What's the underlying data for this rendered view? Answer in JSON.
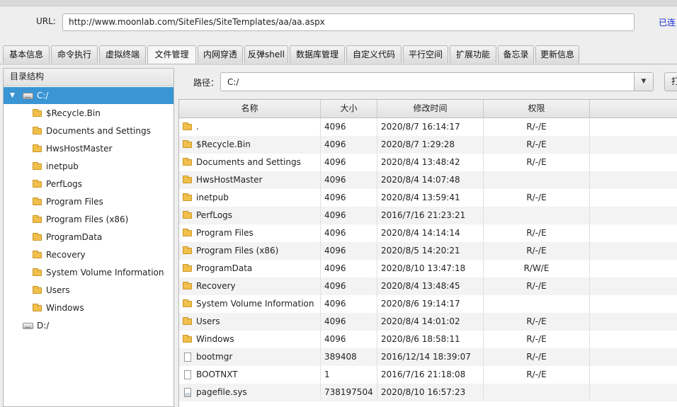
{
  "url_bar": {
    "label": "URL:",
    "value": "http://www.moonlab.com/SiteFiles/SiteTemplates/aa/aa.aspx",
    "status": "已连"
  },
  "tabs": [
    {
      "label": "基本信息"
    },
    {
      "label": "命令执行"
    },
    {
      "label": "虚拟终端"
    },
    {
      "label": "文件管理"
    },
    {
      "label": "内网穿透"
    },
    {
      "label": "反弹shell"
    },
    {
      "label": "数据库管理"
    },
    {
      "label": "自定义代码"
    },
    {
      "label": "平行空间"
    },
    {
      "label": "扩展功能"
    },
    {
      "label": "备忘录"
    },
    {
      "label": "更新信息"
    }
  ],
  "active_tab": "文件管理",
  "tree": {
    "header": "目录结构",
    "drive_c": "C:/",
    "drive_d": "D:/",
    "children": [
      {
        "label": "$Recycle.Bin"
      },
      {
        "label": "Documents and Settings"
      },
      {
        "label": "HwsHostMaster"
      },
      {
        "label": "inetpub"
      },
      {
        "label": "PerfLogs"
      },
      {
        "label": "Program Files"
      },
      {
        "label": "Program Files (x86)"
      },
      {
        "label": "ProgramData"
      },
      {
        "label": "Recovery"
      },
      {
        "label": "System Volume Information"
      },
      {
        "label": "Users"
      },
      {
        "label": "Windows"
      }
    ]
  },
  "path_bar": {
    "label": "路径：",
    "value": "C:/",
    "open_button": "打"
  },
  "table": {
    "headers": {
      "name": "名称",
      "size": "大小",
      "mtime": "修改时间",
      "perm": "权限"
    },
    "rows": [
      {
        "name": ".",
        "size": "4096",
        "mtime": "2020/8/7 16:14:17",
        "perm": "R/-/E",
        "type": "folder"
      },
      {
        "name": "$Recycle.Bin",
        "size": "4096",
        "mtime": "2020/8/7 1:29:28",
        "perm": "R/-/E",
        "type": "folder"
      },
      {
        "name": "Documents and Settings",
        "size": "4096",
        "mtime": "2020/8/4 13:48:42",
        "perm": "R/-/E",
        "type": "folder"
      },
      {
        "name": "HwsHostMaster",
        "size": "4096",
        "mtime": "2020/8/4 14:07:48",
        "perm": "",
        "type": "folder"
      },
      {
        "name": "inetpub",
        "size": "4096",
        "mtime": "2020/8/4 13:59:41",
        "perm": "R/-/E",
        "type": "folder"
      },
      {
        "name": "PerfLogs",
        "size": "4096",
        "mtime": "2016/7/16 21:23:21",
        "perm": "",
        "type": "folder"
      },
      {
        "name": "Program Files",
        "size": "4096",
        "mtime": "2020/8/4 14:14:14",
        "perm": "R/-/E",
        "type": "folder"
      },
      {
        "name": "Program Files (x86)",
        "size": "4096",
        "mtime": "2020/8/5 14:20:21",
        "perm": "R/-/E",
        "type": "folder"
      },
      {
        "name": "ProgramData",
        "size": "4096",
        "mtime": "2020/8/10 13:47:18",
        "perm": "R/W/E",
        "type": "folder"
      },
      {
        "name": "Recovery",
        "size": "4096",
        "mtime": "2020/8/4 13:48:45",
        "perm": "R/-/E",
        "type": "folder"
      },
      {
        "name": "System Volume Information",
        "size": "4096",
        "mtime": "2020/8/6 19:14:17",
        "perm": "",
        "type": "folder"
      },
      {
        "name": "Users",
        "size": "4096",
        "mtime": "2020/8/4 14:01:02",
        "perm": "R/-/E",
        "type": "folder"
      },
      {
        "name": "Windows",
        "size": "4096",
        "mtime": "2020/8/6 18:58:11",
        "perm": "R/-/E",
        "type": "folder"
      },
      {
        "name": "bootmgr",
        "size": "389408",
        "mtime": "2016/12/14 18:39:07",
        "perm": "R/-/E",
        "type": "file"
      },
      {
        "name": "BOOTNXT",
        "size": "1",
        "mtime": "2016/7/16 21:18:08",
        "perm": "R/-/E",
        "type": "file"
      },
      {
        "name": "pagefile.sys",
        "size": "738197504",
        "mtime": "2020/8/10 16:57:23",
        "perm": "",
        "type": "sys"
      }
    ]
  }
}
